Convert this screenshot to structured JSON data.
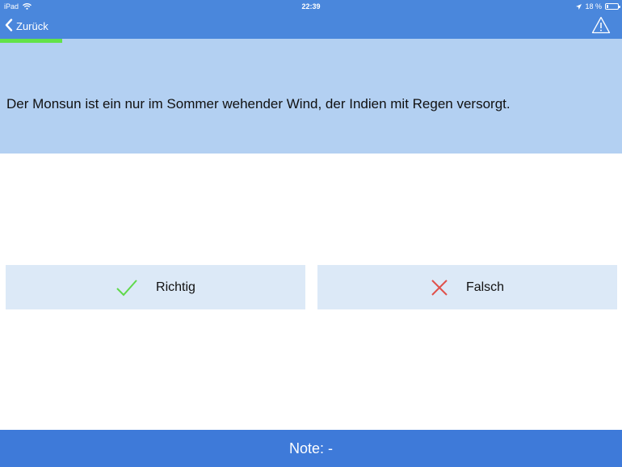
{
  "status_bar": {
    "device": "iPad",
    "time": "22:39",
    "battery": "18 %",
    "battery_level": 0.18,
    "icons": [
      "wifi-icon",
      "location-arrow-icon",
      "battery-icon"
    ]
  },
  "nav": {
    "back_label": "Zurück",
    "icons": [
      "chevron-left-icon",
      "warning-triangle-icon"
    ]
  },
  "progress": {
    "fraction": 0.1,
    "color": "#62e349"
  },
  "question": {
    "text": "Der Monsun ist ein nur im Sommer wehender Wind, der Indien mit Regen versorgt."
  },
  "answers": {
    "true_label": "Richtig",
    "false_label": "Falsch",
    "true_icon": "checkmark-icon",
    "false_icon": "cross-icon",
    "true_color": "#5fd94a",
    "false_color": "#e0514b"
  },
  "footer": {
    "grade_text": "Note: -"
  },
  "colors": {
    "bar_blue": "#4a87dc",
    "panel_blue": "#b3d0f2",
    "button_bg": "#dce9f7",
    "footer_blue": "#3e7ad9"
  }
}
